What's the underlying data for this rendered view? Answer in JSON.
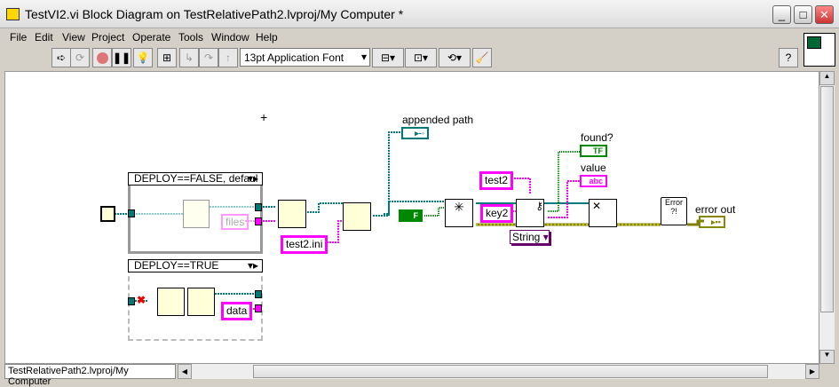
{
  "window": {
    "title": "TestVI2.vi Block Diagram on TestRelativePath2.lvproj/My Computer *"
  },
  "menu": [
    "File",
    "Edit",
    "View",
    "Project",
    "Operate",
    "Tools",
    "Window",
    "Help"
  ],
  "toolbar": {
    "font": "13pt Application Font"
  },
  "diagram": {
    "case1": "DEPLOY==FALSE, defaul",
    "case2": "DEPLOY==TRUE",
    "const_files": "files",
    "const_data": "data",
    "const_test2ini": "test2.ini",
    "const_test2": "test2",
    "const_key2": "key2",
    "type_select": "String",
    "bool_const": "F",
    "ind_appended_path": "appended path",
    "ind_found": "found?",
    "ind_found_glyph": "TF",
    "ind_value": "value",
    "ind_value_glyph": "abc",
    "ind_error_out": "error out",
    "error_node": "Error ?!"
  },
  "status": {
    "context": "TestRelativePath2.lvproj/My Computer"
  },
  "colors": {
    "path_wire": "#007b7b",
    "string_wire": "#ff00ff",
    "bool_wire": "#008000",
    "error_wire": "#808000"
  }
}
